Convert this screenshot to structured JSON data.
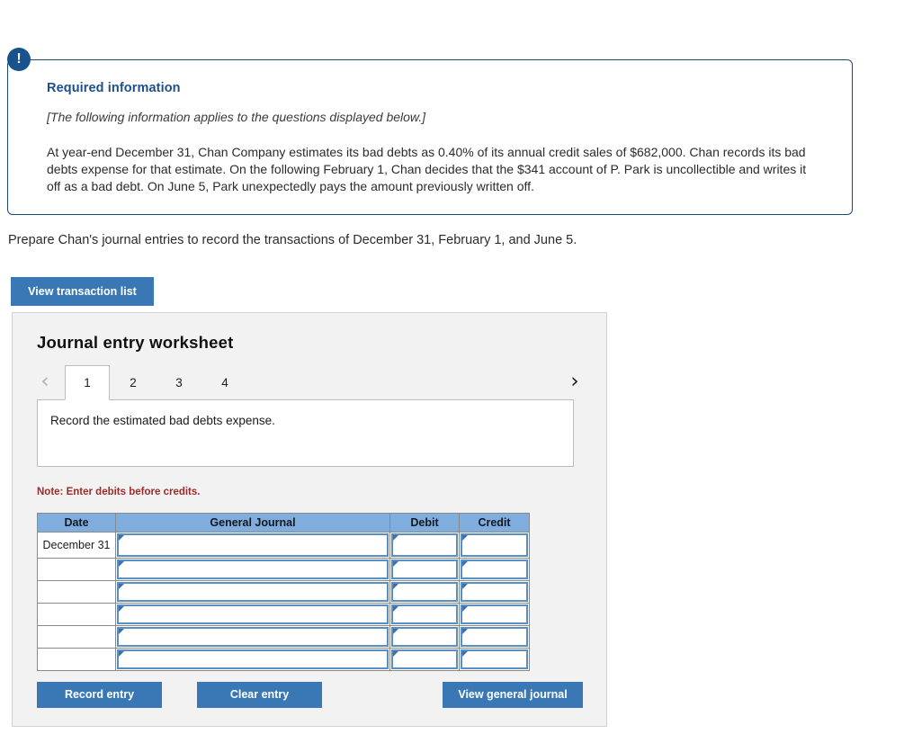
{
  "callout": {
    "icon": "exclamation-icon",
    "badge_glyph": "!",
    "title": "Required information",
    "italic_note": "[The following information applies to the questions displayed below.]",
    "body": "At year-end December 31, Chan Company estimates its bad debts as 0.40% of its annual credit sales of $682,000. Chan records its bad debts expense for that estimate. On the following February 1, Chan decides that the $341 account of P. Park is uncollectible and writes it off as a bad debt. On June 5, Park unexpectedly pays the amount previously written off.",
    "border_color": "#1a4a7a",
    "title_color": "#1d4f8c"
  },
  "prompt": {
    "text": "Prepare Chan's journal entries to record the transactions of December 31, February 1, and June 5."
  },
  "transaction_button": {
    "label": "View transaction list"
  },
  "worksheet": {
    "title": "Journal entry worksheet",
    "nav": {
      "prev_glyph": "‹",
      "next_glyph": "›",
      "prev_enabled": false,
      "next_enabled": true
    },
    "tabs": [
      {
        "label": "1",
        "active": true
      },
      {
        "label": "2",
        "active": false
      },
      {
        "label": "3",
        "active": false
      },
      {
        "label": "4",
        "active": false
      }
    ],
    "instruction": "Record the estimated bad debts expense.",
    "note": "Note: Enter debits before credits.",
    "note_color": "#9c2b2b",
    "table": {
      "header_color": "#7fadde",
      "columns": [
        "Date",
        "General Journal",
        "Debit",
        "Credit"
      ],
      "rows": [
        {
          "date": "December 31",
          "general_journal": "",
          "debit": "",
          "credit": ""
        },
        {
          "date": "",
          "general_journal": "",
          "debit": "",
          "credit": ""
        },
        {
          "date": "",
          "general_journal": "",
          "debit": "",
          "credit": ""
        },
        {
          "date": "",
          "general_journal": "",
          "debit": "",
          "credit": ""
        },
        {
          "date": "",
          "general_journal": "",
          "debit": "",
          "credit": ""
        },
        {
          "date": "",
          "general_journal": "",
          "debit": "",
          "credit": ""
        }
      ]
    },
    "buttons": {
      "record": "Record entry",
      "clear": "Clear entry",
      "view_general_journal": "View general journal",
      "color": "#3a78b5"
    }
  }
}
